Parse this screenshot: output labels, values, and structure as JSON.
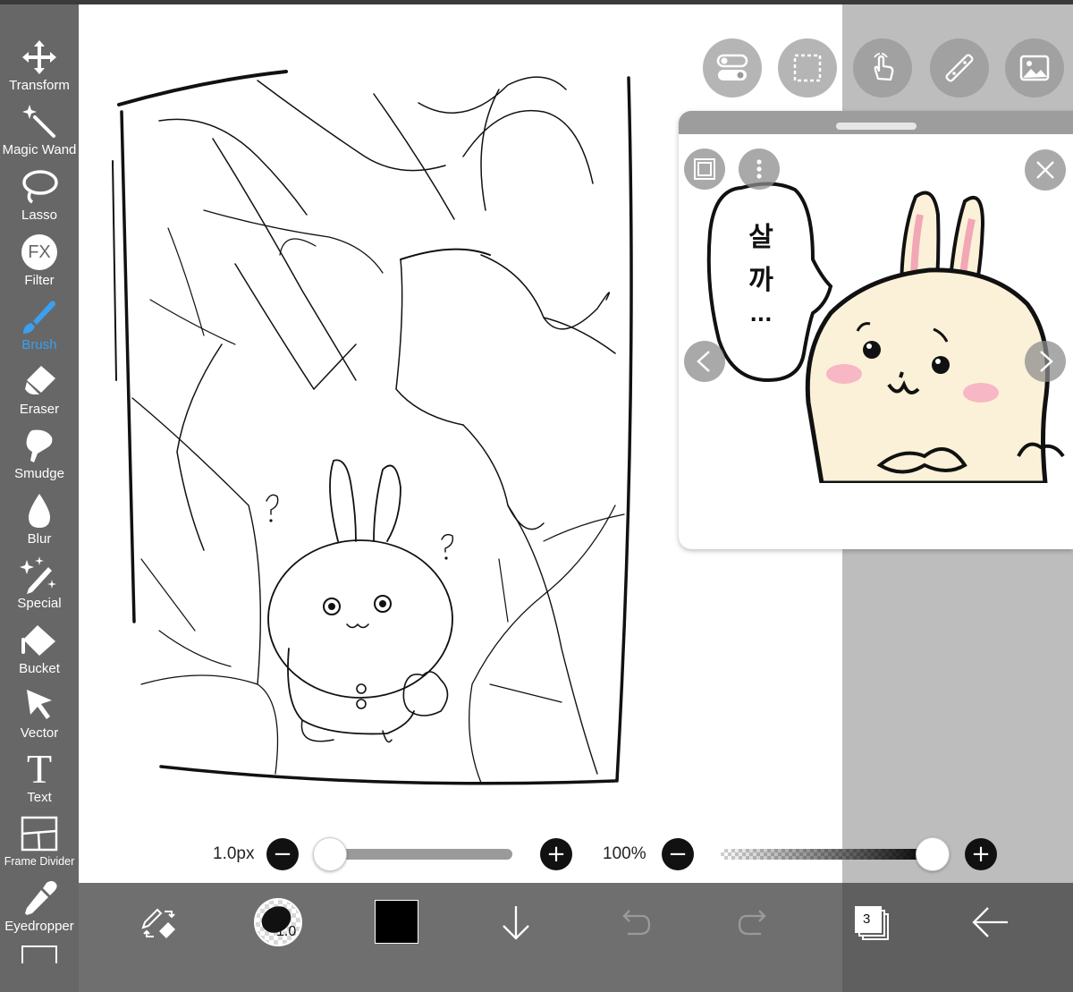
{
  "toolbar": {
    "items": [
      {
        "label": "Transform",
        "icon": "move-arrows-icon"
      },
      {
        "label": "Magic Wand",
        "icon": "magic-wand-icon"
      },
      {
        "label": "Lasso",
        "icon": "lasso-icon"
      },
      {
        "label": "Filter",
        "icon": "fx-icon"
      },
      {
        "label": "Brush",
        "icon": "brush-icon",
        "selected": true
      },
      {
        "label": "Eraser",
        "icon": "eraser-icon"
      },
      {
        "label": "Smudge",
        "icon": "smudge-icon"
      },
      {
        "label": "Blur",
        "icon": "droplet-icon"
      },
      {
        "label": "Special",
        "icon": "special-pen-icon"
      },
      {
        "label": "Bucket",
        "icon": "bucket-icon"
      },
      {
        "label": "Vector",
        "icon": "cursor-arrow-icon"
      },
      {
        "label": "Text",
        "icon": "text-t-icon"
      },
      {
        "label": "Frame Divider",
        "icon": "frame-divider-icon"
      },
      {
        "label": "Eyedropper",
        "icon": "eyedropper-icon"
      }
    ],
    "fx_glyph": "FX",
    "text_glyph": "T"
  },
  "floating_buttons": [
    "toggle-switch-icon",
    "selection-rect-icon",
    "hand-gesture-icon",
    "ruler-icon",
    "image-reference-icon"
  ],
  "reference_window": {
    "speech_text": [
      "살",
      "까",
      "..."
    ]
  },
  "sliders": {
    "brush_size": {
      "value_label": "1.0px",
      "fraction": 0.0
    },
    "opacity": {
      "value_label": "100%",
      "fraction": 1.0
    },
    "minus": "−",
    "plus": "+"
  },
  "bottombar": {
    "brush_size_badge": "1.0",
    "color": "#000000",
    "layer_count": "3",
    "undo_enabled": false,
    "redo_enabled": false
  },
  "colors": {
    "toolbar": "#676767",
    "selected_tool": "#3aa0f0",
    "canvas": "#ffffff",
    "bottom_bar": "#6f6f6f",
    "reference_bg": "#fdf3d9"
  }
}
